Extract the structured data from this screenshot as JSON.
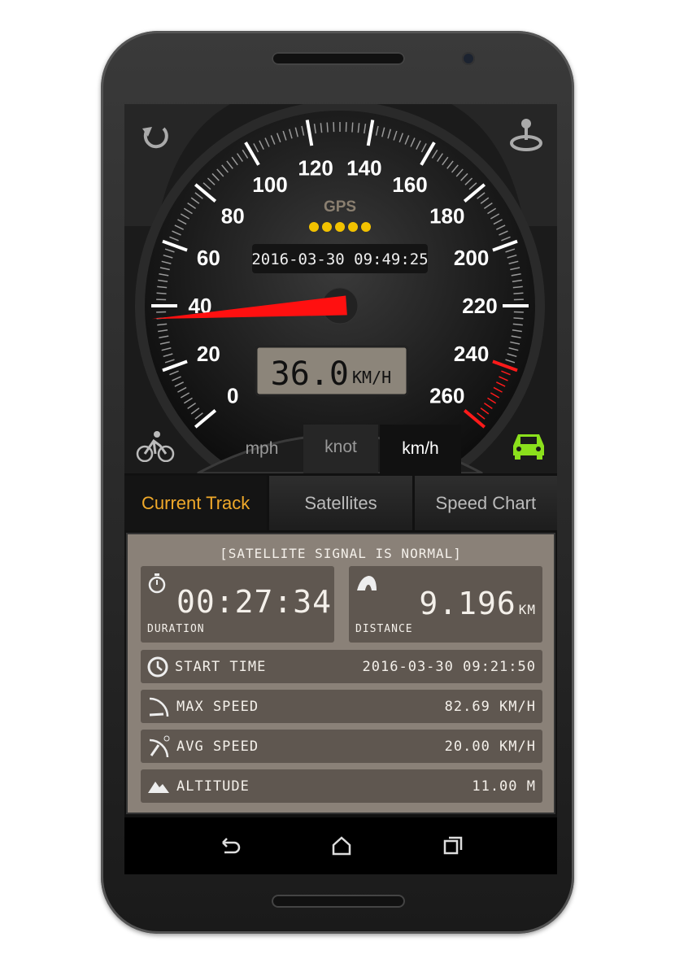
{
  "gauge": {
    "labels": [
      "0",
      "20",
      "40",
      "60",
      "80",
      "100",
      "120",
      "140",
      "160",
      "180",
      "200",
      "220",
      "240",
      "260"
    ],
    "min": 0,
    "max": 260,
    "speed": 36.0,
    "gps_label": "GPS",
    "gps_dots": 5,
    "datetime": "2016-03-30 09:49:25",
    "speed_display": "36.0",
    "speed_unit": "KM/H",
    "redline_from": 240,
    "accent_red": "#ff1a1a",
    "dot_color": "#f2c200"
  },
  "units": {
    "items": [
      "mph",
      "knot",
      "km/h"
    ],
    "selected": "km/h"
  },
  "icons": {
    "refresh": "refresh-icon",
    "joystick": "joystick-icon",
    "bicycle": "bicycle-icon",
    "car": "car-icon",
    "car_color": "#8be01c"
  },
  "tabs": [
    {
      "label": "Current Track",
      "active": true
    },
    {
      "label": "Satellites"
    },
    {
      "label": "Speed Chart"
    }
  ],
  "track": {
    "status": "[SATELLITE SIGNAL IS NORMAL]",
    "duration": {
      "value": "00:27:34",
      "label": "DURATION"
    },
    "distance": {
      "value": "9.196",
      "unit": "KM",
      "label": "DISTANCE"
    },
    "rows": [
      {
        "label": "START TIME",
        "value": "2016-03-30 09:21:50"
      },
      {
        "label": "MAX SPEED",
        "value": "82.69 KM/H"
      },
      {
        "label": "AVG SPEED",
        "value": "20.00 KM/H"
      },
      {
        "label": "ALTITUDE",
        "value": "11.00 M"
      }
    ]
  }
}
